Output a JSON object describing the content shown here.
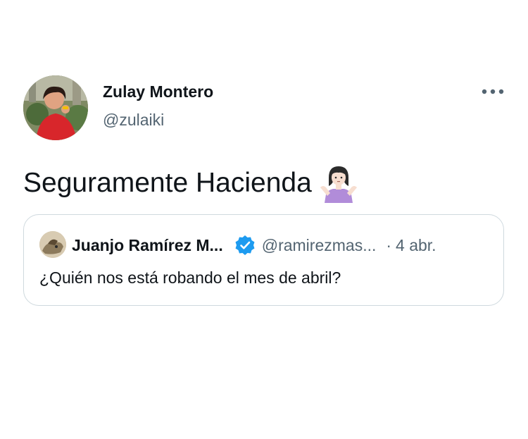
{
  "tweet": {
    "author_name": "Zulay Montero",
    "author_handle": "@zulaiki",
    "text": "Seguramente Hacienda",
    "emoji_icon": "woman-shrugging-emoji-icon",
    "more_icon": "more-horizontal-icon"
  },
  "quoted_tweet": {
    "author_name": "Juanjo Ramírez M...",
    "verified_icon": "verified-badge-icon",
    "author_handle": "@ramirezmas...",
    "separator": "·",
    "timestamp": "4 abr.",
    "text": "¿Quién nos está robando el mes de abril?"
  },
  "colors": {
    "text_primary": "#0f1419",
    "text_secondary": "#536471",
    "border": "#cfd9de",
    "verified_blue": "#1d9bf0"
  }
}
